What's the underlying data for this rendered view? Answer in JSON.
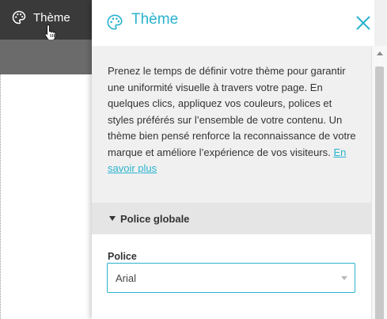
{
  "topbar": {
    "theme_label": "Thème",
    "theme_icon": "palette-icon"
  },
  "panel": {
    "title": "Thème",
    "title_icon": "palette-icon",
    "close_icon": "close-icon",
    "intro": "Prenez le temps de définir votre thème pour garantir une uniformité visuelle à travers votre page. En quelques clics, appliquez vos couleurs, polices et styles préférés sur l’ensemble de votre contenu. Un thème bien pensé renforce la reconnaissance de votre marque et améliore l’expérience de vos visiteurs.",
    "learn_more": "En savoir plus",
    "section_title": "Police globale",
    "font_label": "Police",
    "font_value": "Arial"
  },
  "colors": {
    "accent": "#2ab3cf",
    "topbar": "#3a3a3a",
    "panel_bg": "#f0f0f0"
  }
}
